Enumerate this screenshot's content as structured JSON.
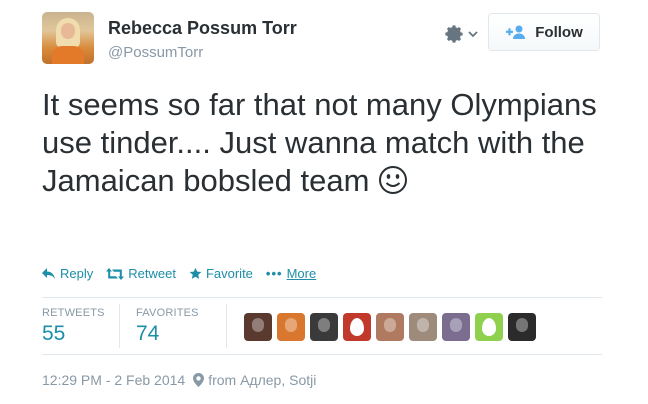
{
  "author": {
    "name": "Rebecca Possum Torr",
    "handle": "@PossumTorr"
  },
  "header": {
    "gear_icon": "gear-icon",
    "follow_label": "Follow",
    "follow_icon": "add-user-icon"
  },
  "tweet": {
    "text": "It seems so far that not many Olympians use tinder.... Just wanna match with the Jamaican bobsled team",
    "emoji": "smiley-face-icon"
  },
  "actions": {
    "reply": "Reply",
    "retweet": "Retweet",
    "favorite": "Favorite",
    "more": "More"
  },
  "stats": {
    "retweets_label": "RETWEETS",
    "retweets_value": "55",
    "favorites_label": "FAVORITES",
    "favorites_value": "74"
  },
  "favoriters": [
    {
      "kind": "photo",
      "color": "#5a3a2e"
    },
    {
      "kind": "photo",
      "color": "#d9772e"
    },
    {
      "kind": "photo",
      "color": "#3a3a3a"
    },
    {
      "kind": "egg",
      "color": "#c0392b"
    },
    {
      "kind": "photo",
      "color": "#b07a60"
    },
    {
      "kind": "photo",
      "color": "#9e8b7b"
    },
    {
      "kind": "photo",
      "color": "#7a6d8f"
    },
    {
      "kind": "egg",
      "color": "#8fd14f"
    },
    {
      "kind": "photo",
      "color": "#2b2b2b"
    }
  ],
  "meta": {
    "timestamp": "12:29 PM - 2 Feb 2014",
    "location": "from Адлер, Sotji",
    "location_icon": "map-pin-icon"
  },
  "colors": {
    "link": "#1c8ea7",
    "muted": "#8899a6",
    "text": "#292f33"
  }
}
